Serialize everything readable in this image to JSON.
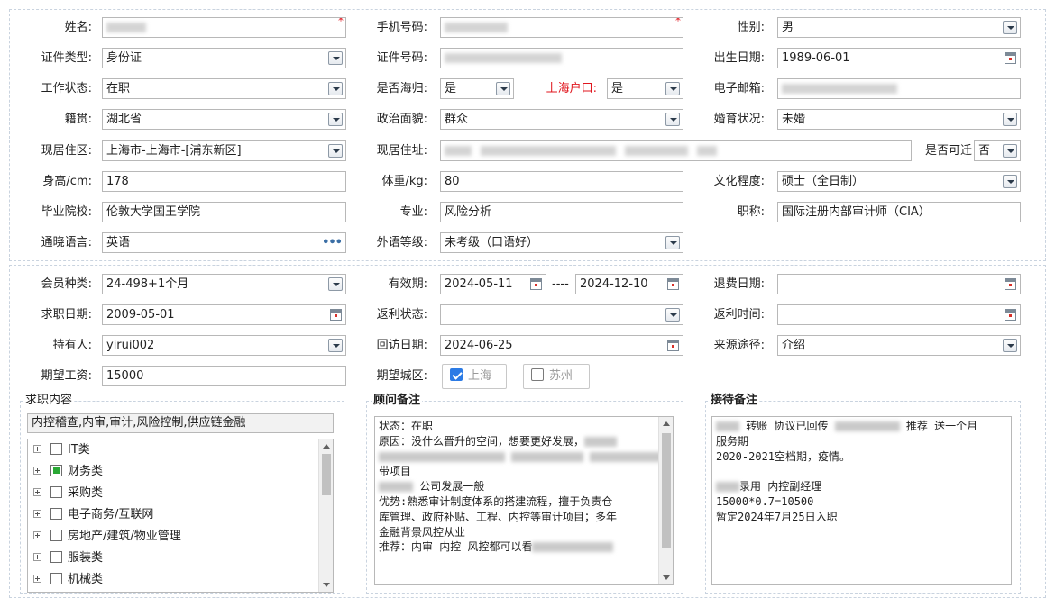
{
  "basic": {
    "name_label": "姓名:",
    "phone_label": "手机号码:",
    "gender_label": "性别:",
    "gender_value": "男",
    "required_mark": "*",
    "id_type_label": "证件类型:",
    "id_type_value": "身份证",
    "id_number_label": "证件号码:",
    "birth_label": "出生日期:",
    "birth_value": "1989-06-01",
    "work_status_label": "工作状态:",
    "work_status_value": "在职",
    "returnee_label": "是否海归:",
    "returnee_value": "是",
    "shanghai_hukou_label": "上海户口:",
    "shanghai_hukou_value": "是",
    "email_label": "电子邮箱:",
    "native_label": "籍贯:",
    "native_value": "湖北省",
    "political_label": "政治面貌:",
    "political_value": "群众",
    "marital_label": "婚育状况:",
    "marital_value": "未婚",
    "residence_area_label": "现居住区:",
    "residence_area_value": " 上海市-上海市-[浦东新区]",
    "residence_addr_label": "现居住址:",
    "relocate_label": "是否可迁",
    "relocate_value": "否",
    "height_label": "身高/cm:",
    "height_value": "178",
    "weight_label": "体重/kg:",
    "weight_value": "80",
    "education_label": "文化程度:",
    "education_value": "硕士（全日制）",
    "school_label": "毕业院校:",
    "school_value": "伦敦大学国王学院",
    "major_label": "专业:",
    "major_value": "风险分析",
    "title_label": "职称:",
    "title_value": "国际注册内部审计师（CIA）",
    "language_label": "通晓语言:",
    "language_value": "英语",
    "language_more": "•••",
    "foreign_level_label": "外语等级:",
    "foreign_level_value": "未考级（口语好）"
  },
  "membership": {
    "member_type_label": "会员种类:",
    "member_type_value": " 24-498+1个月",
    "valid_label": "有效期:",
    "valid_from": "2024-05-11",
    "valid_sep": "----",
    "valid_to": "2024-12-10",
    "refund_date_label": "退费日期:",
    "job_date_label": "求职日期:",
    "job_date_value": "2009-05-01",
    "rebate_status_label": "返利状态:",
    "rebate_time_label": "返利时间:",
    "holder_label": "持有人:",
    "holder_value": "yirui002",
    "visit_date_label": "回访日期:",
    "visit_date_value": "2024-06-25",
    "source_label": "来源途径:",
    "source_value": "介绍",
    "salary_label": "期望工资:",
    "salary_value": "15000",
    "city_label": "期望城区:",
    "city_opt1": "上海",
    "city_opt2": "苏州"
  },
  "job": {
    "title": "求职内容",
    "summary": "内控稽查,内审,审计,风险控制,供应链金融",
    "tree": [
      "IT类",
      "财务类",
      "采购类",
      "电子商务/互联网",
      "房地产/建筑/物业管理",
      "服装类",
      "机械类"
    ]
  },
  "advisor": {
    "title": "顾问备注",
    "l1": "状态：在职",
    "l2": "原因：没什么晋升的空间，想要更好发展，",
    "l4": "带项目",
    "l5": " 公司发展一般",
    "l6": "优势:熟悉审计制度体系的搭建流程，擅于负责仓",
    "l7": "库管理、政府补贴、工程、内控等审计项目；多年",
    "l8": "金融背景风控从业",
    "l9": "推荐：内审 内控 风控都可以看"
  },
  "reception": {
    "title": "接待备注",
    "l1a": " 转账 协议已回传 ",
    "l1b": " 推荐 送一个月",
    "l2": "服务期",
    "l3": "2020-2021空档期，疫情。",
    "l5": "录用  内控副经理",
    "l6": "15000*0.7=10500",
    "l7": "暂定2024年7月25日入职"
  }
}
